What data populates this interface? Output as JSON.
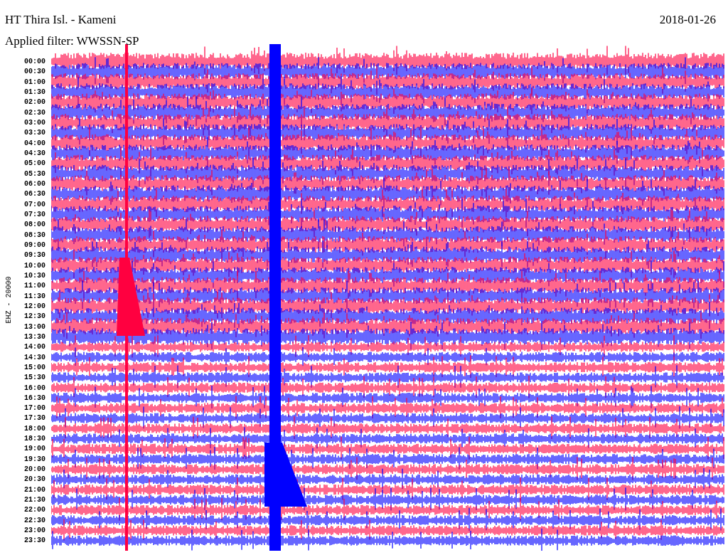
{
  "header": {
    "station": "HT Thira Isl. - Kameni",
    "date": "2018-01-26",
    "filter": "Applied filter: WWSSN-SP"
  },
  "channel_label": "EHZ - 20000",
  "time_labels": [
    "00:00",
    "00:30",
    "01:00",
    "01:30",
    "02:00",
    "02:30",
    "03:00",
    "03:30",
    "04:00",
    "04:30",
    "05:00",
    "05:30",
    "06:00",
    "06:30",
    "07:00",
    "07:30",
    "08:00",
    "08:30",
    "09:00",
    "09:30",
    "10:00",
    "10:30",
    "11:00",
    "11:30",
    "12:00",
    "12:30",
    "13:00",
    "13:30",
    "14:00",
    "14:30",
    "15:00",
    "15:30",
    "16:00",
    "16:30",
    "17:00",
    "17:30",
    "18:00",
    "18:30",
    "19:00",
    "19:30",
    "20:00",
    "20:30",
    "21:00",
    "21:30",
    "22:00",
    "22:30",
    "23:00",
    "23:30"
  ]
}
